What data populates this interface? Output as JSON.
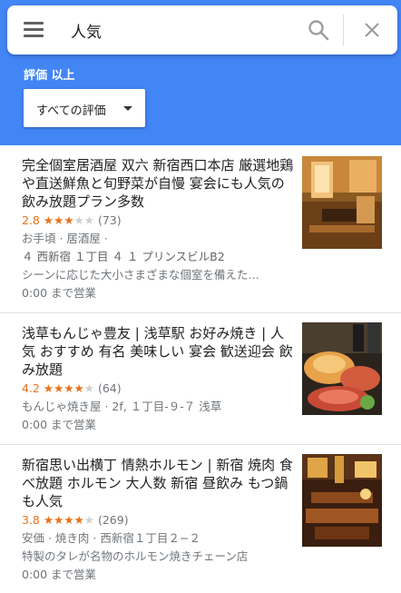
{
  "search": {
    "query": "人気"
  },
  "filter": {
    "label": "評価 以上",
    "selected": "すべての評価"
  },
  "colors": {
    "header": "#4285f4",
    "rating": "#e7711b"
  },
  "results": [
    {
      "title": "完全個室居酒屋 双六 新宿西口本店 厳選地鶏や直送鮮魚と旬野菜が自慢 宴会にも人気の飲み放題プラン多数",
      "rating": "2.8",
      "stars_filled": 3,
      "reviews": "(73)",
      "category": "お手頃 · 居酒屋 ·",
      "address": "４ 西新宿 １丁目 ４ １ プリンスビルB2",
      "description": "シーンに応じた大小さまざまな個室を備えた…",
      "hours": "0:00 まで営業",
      "image": "restaurant-interior-photo"
    },
    {
      "title": "浅草もんじゃ豊友 | 浅草駅 お好み焼き | 人気 おすすめ 有名 美味しい 宴会 歓送迎会 飲み放題",
      "rating": "4.2",
      "stars_filled": 4,
      "reviews": "(64)",
      "category": "もんじゃ焼き屋 · 2f, １丁目-９-７ 浅草",
      "hours": "0:00 まで営業",
      "image": "monja-food-photo"
    },
    {
      "title": "新宿思い出横丁 情熱ホルモン | 新宿 焼肉 食べ放題 ホルモン 大人数 新宿 昼飲み もつ鍋も人気",
      "rating": "3.8",
      "stars_filled": 4,
      "reviews": "(269)",
      "category": "安価 · 焼き肉 · 西新宿１丁目２−２",
      "description": "特製のタレが名物のホルモン焼きチェーン店",
      "hours": "0:00 まで営業",
      "image": "yakiniku-interior-photo"
    }
  ]
}
